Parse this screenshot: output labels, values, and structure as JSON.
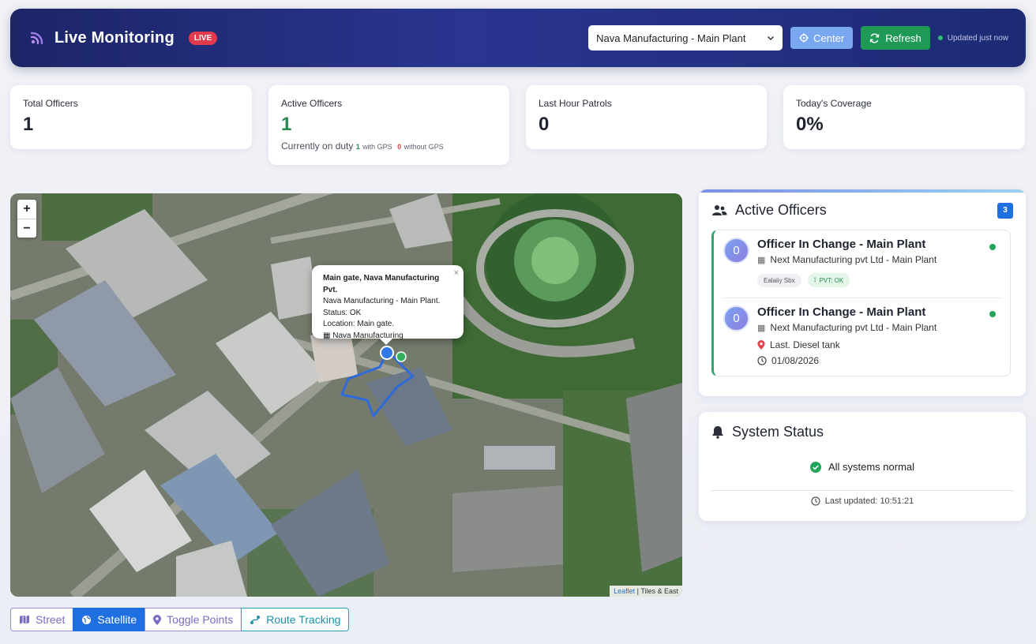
{
  "header": {
    "title": "Live Monitoring",
    "live_badge": "LIVE",
    "plant_select_value": "Nava Manufacturing - Main Plant",
    "center_label": "Center",
    "refresh_label": "Refresh",
    "updated_text": "Updated just now",
    "brand_color": "#1c2566"
  },
  "stats": [
    {
      "label": "Total Officers",
      "value": "1"
    },
    {
      "label": "Active Officers",
      "value": "1",
      "sub": "Currently on duty",
      "with_gps_count": "1",
      "with_gps_label": "with GPS",
      "without_gps_count": "0",
      "without_gps_label": "without GPS"
    },
    {
      "label": "Last Hour Patrols",
      "value": "0"
    },
    {
      "label": "Today's Coverage",
      "value": "0%"
    }
  ],
  "map": {
    "zoom_in": "+",
    "zoom_out": "−",
    "popup": {
      "title": "Main gate, Nava Manufacturing Pvt.",
      "line1": "Nava Manufacturing - Main Plant.",
      "line2": "Status: OK",
      "line3": "Location: Main gate.",
      "line4": "Nava Manufacturing",
      "close": "×"
    },
    "attribution_leaflet": "Leaflet",
    "attribution_tiles": "| Tiles & East"
  },
  "layers": {
    "street": "Street",
    "satellite": "Satellite",
    "toggle_points": "Toggle Points",
    "route_tracking": "Route Tracking"
  },
  "officers_panel": {
    "title": "Active Officers",
    "count": "3",
    "officers": [
      {
        "initial": "0",
        "name": "Officer In Change - Main Plant",
        "company": "Next Manufacturing pvt Ltd - Main Plant",
        "chip1": "Ealaiiy Sbx",
        "chip2": "PVT: OK"
      },
      {
        "initial": "0",
        "name": "Officer In Change - Main Plant",
        "company": "Next Manufacturing pvt Ltd - Main Plant",
        "location": "Last. Diesel tank",
        "date": "01/08/2026"
      }
    ]
  },
  "system_status": {
    "title": "System Status",
    "status": "All systems normal",
    "last_updated": "Last updated: 10:51:21"
  }
}
